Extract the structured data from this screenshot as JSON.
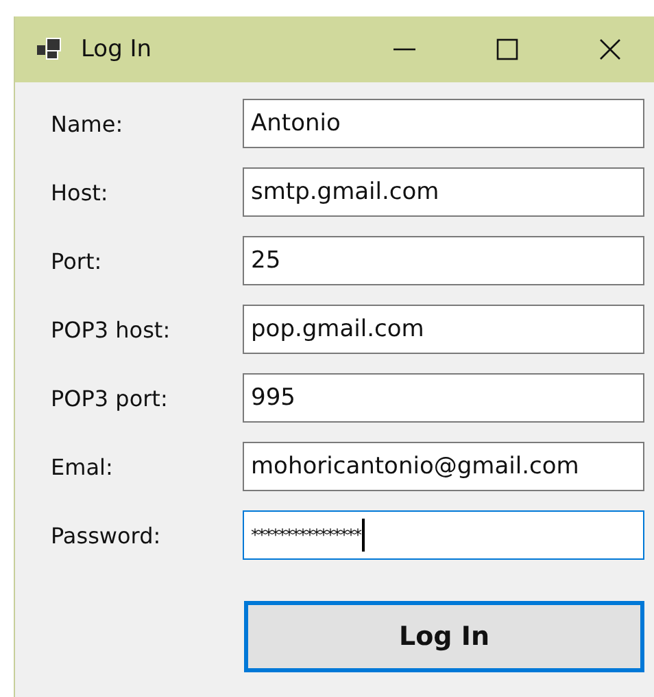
{
  "window": {
    "title": "Log In"
  },
  "fields": [
    {
      "label": "Name:",
      "value": "Antonio",
      "focused": false
    },
    {
      "label": "Host:",
      "value": "smtp.gmail.com",
      "focused": false
    },
    {
      "label": "Port:",
      "value": "25",
      "focused": false
    },
    {
      "label": "POP3 host:",
      "value": "pop.gmail.com",
      "focused": false
    },
    {
      "label": "POP3 port:",
      "value": "995",
      "focused": false
    },
    {
      "label": "Emal:",
      "value": "mohoricantonio@gmail.com",
      "focused": false
    },
    {
      "label": "Password:",
      "value": "****************",
      "focused": true
    }
  ],
  "button": {
    "label": "Log In"
  }
}
